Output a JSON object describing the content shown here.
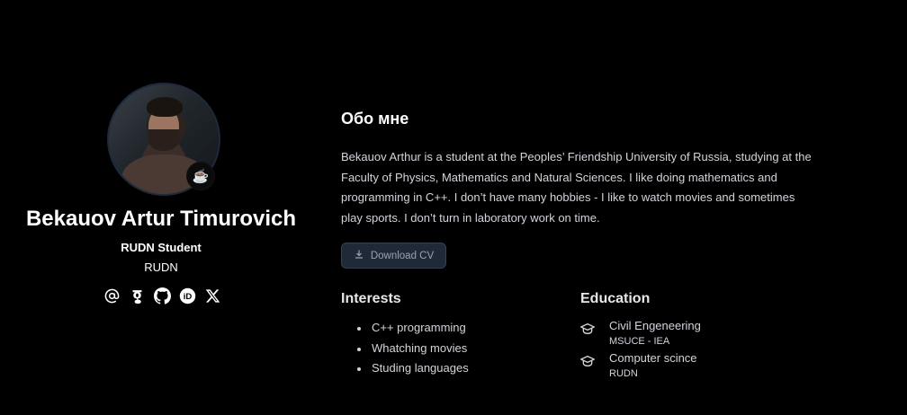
{
  "profile": {
    "name": "Bekauov Artur Timurovich",
    "role": "RUDN Student",
    "organization": "RUDN",
    "badge_emoji": "☕",
    "socials": [
      {
        "icon": "at-email-icon"
      },
      {
        "icon": "google-scholar-icon"
      },
      {
        "icon": "github-icon"
      },
      {
        "icon": "orcid-icon"
      },
      {
        "icon": "x-twitter-icon"
      }
    ]
  },
  "about": {
    "title": "Обо мне",
    "text": "Bekauov Arthur is a student at the Peoples’ Friendship University of Russia, studying at the Faculty of Physics, Mathematics and Natural Sciences. I like doing mathematics and programming in C++. I don’t have many hobbies - I like to watch movies and sometimes play sports. I don’t turn in laboratory work on time.",
    "download_label": "Download CV"
  },
  "interests": {
    "title": "Interests",
    "items": [
      "C++ programming",
      "Whatching movies",
      "Studing languages"
    ]
  },
  "education": {
    "title": "Education",
    "items": [
      {
        "degree": "Civil Engeneering",
        "school": "MSUCE - IEA"
      },
      {
        "degree": "Computer scince",
        "school": "RUDN"
      }
    ]
  }
}
